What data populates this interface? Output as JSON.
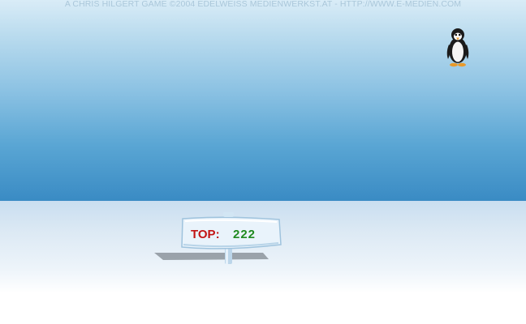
{
  "credits": "A CHRIS HILGERT GAME ©2004 EDELWEISS MEDIENWERKST.AT - HTTP://WWW.E-MEDIEN.COM",
  "penguin": {
    "icon": "penguin-icon"
  },
  "scoreboard": {
    "label": "TOP:",
    "value": "222"
  },
  "colors": {
    "label": "#c21414",
    "value": "#1f8a1f",
    "credits": "#aac7da"
  }
}
